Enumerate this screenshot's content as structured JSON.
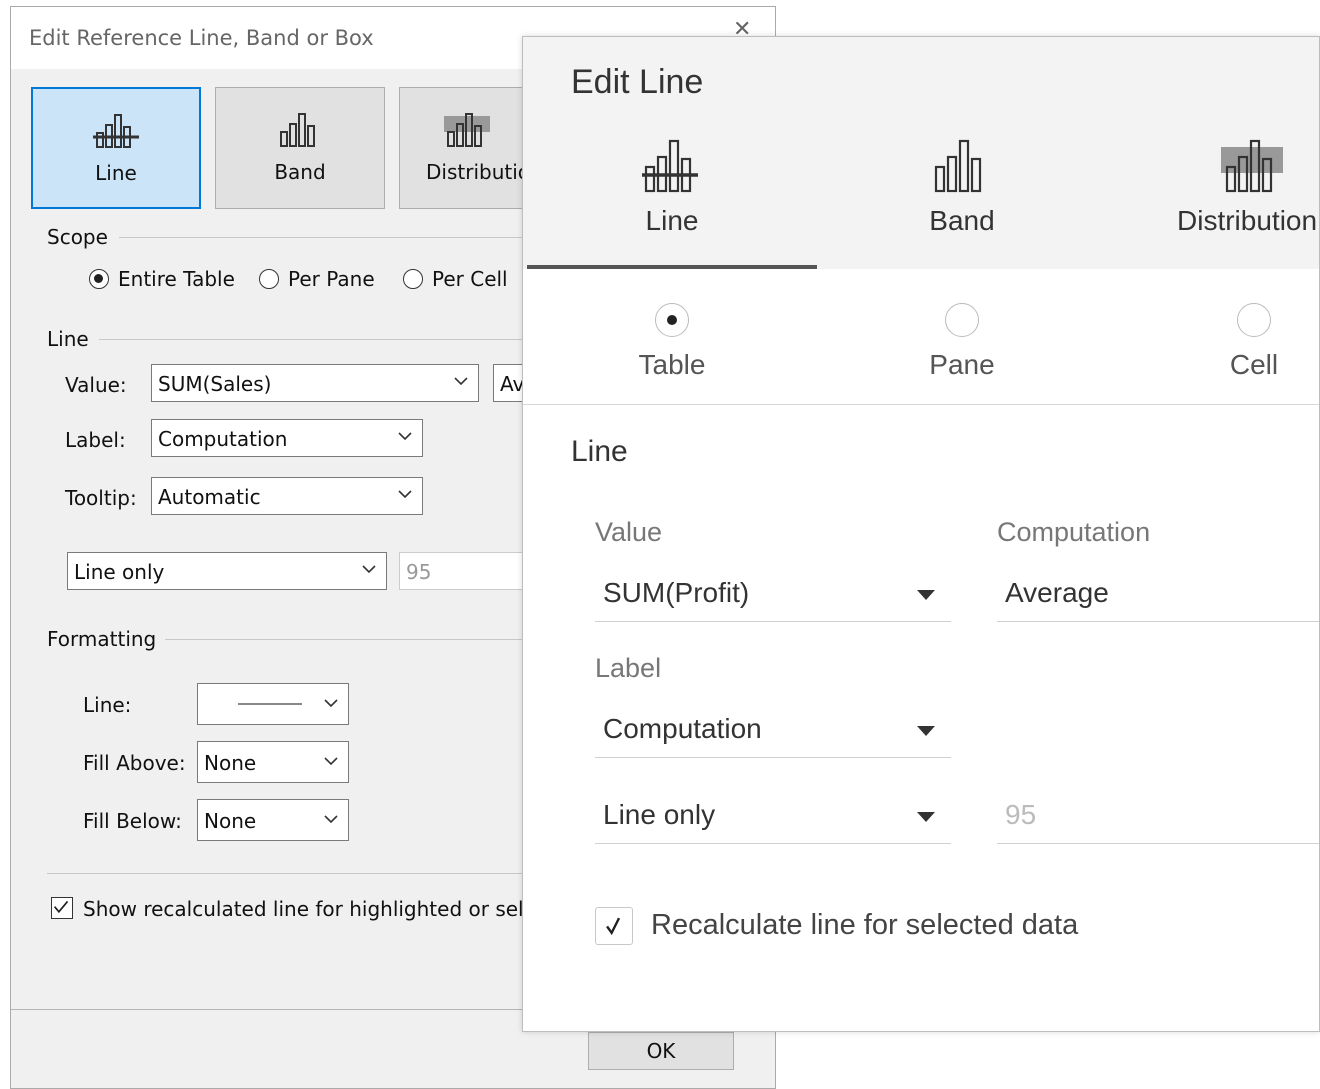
{
  "old_dialog": {
    "title": "Edit Reference Line, Band or Box",
    "tabs": [
      {
        "label": "Line",
        "selected": true
      },
      {
        "label": "Band",
        "selected": false
      },
      {
        "label": "Distributio",
        "selected": false
      }
    ],
    "scope": {
      "label": "Scope",
      "options": [
        {
          "label": "Entire Table",
          "selected": true
        },
        {
          "label": "Per Pane",
          "selected": false
        },
        {
          "label": "Per Cell",
          "selected": false
        }
      ]
    },
    "line_section": {
      "label": "Line",
      "value_label": "Value:",
      "value": "SUM(Sales)",
      "aggregation_partial": "Av",
      "label_label": "Label:",
      "label_value": "Computation",
      "tooltip_label": "Tooltip:",
      "tooltip_value": "Automatic",
      "interval_value": "Line only",
      "confidence_value": "95"
    },
    "formatting": {
      "label": "Formatting",
      "line_label": "Line:",
      "fill_above_label": "Fill Above:",
      "fill_above_value": "None",
      "fill_below_label": "Fill Below:",
      "fill_below_value": "None"
    },
    "recalc_checkbox": {
      "label": "Show recalculated line for highlighted or selec",
      "checked": true
    },
    "ok_label": "OK"
  },
  "new_dialog": {
    "title": "Edit Line",
    "tabs": [
      {
        "label": "Line",
        "selected": true
      },
      {
        "label": "Band",
        "selected": false
      },
      {
        "label": "Distribution",
        "selected": false
      }
    ],
    "scope_options": [
      {
        "label": "Table",
        "selected": true
      },
      {
        "label": "Pane",
        "selected": false
      },
      {
        "label": "Cell",
        "selected": false
      }
    ],
    "section_title": "Line",
    "value_caption": "Value",
    "value": "SUM(Profit)",
    "computation_caption": "Computation",
    "computation": "Average",
    "label_caption": "Label",
    "label_value": "Computation",
    "interval_value": "Line only",
    "confidence_value": "95",
    "recalc_checkbox": {
      "label": "Recalculate line for selected data",
      "checked": true
    }
  },
  "colors": {
    "selected_tab_bg": "#cce4f7",
    "selected_tab_border": "#0078d7",
    "new_header_bg": "#f3f3f3"
  }
}
